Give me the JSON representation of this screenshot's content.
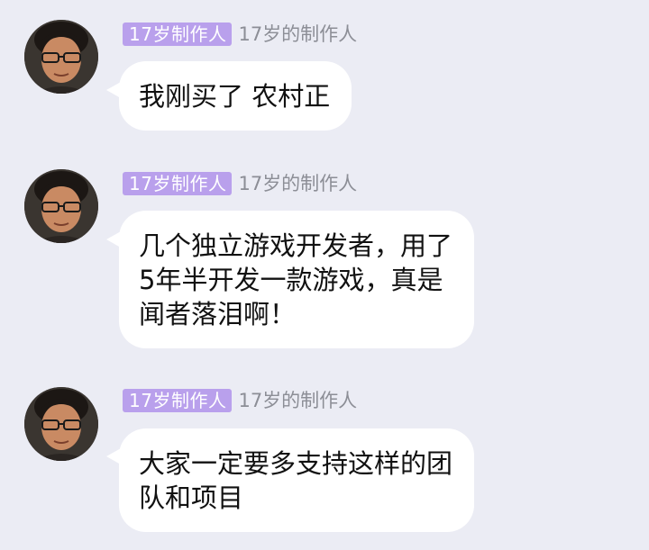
{
  "messages": [
    {
      "badge": "17岁制作人",
      "nickname": "17岁的制作人",
      "text": "我刚买了 农村正",
      "avatar_icon": "user-avatar"
    },
    {
      "badge": "17岁制作人",
      "nickname": "17岁的制作人",
      "text": "几个独立游戏开发者，用了\n5年半开发一款游戏，真是\n闻者落泪啊！",
      "avatar_icon": "user-avatar"
    },
    {
      "badge": "17岁制作人",
      "nickname": "17岁的制作人",
      "text": "大家一定要多支持这样的团\n队和项目",
      "avatar_icon": "user-avatar"
    }
  ],
  "colors": {
    "background": "#ebecf4",
    "badge": "#b9a0ec",
    "nickname": "#8c8e96",
    "bubble": "#ffffff"
  }
}
